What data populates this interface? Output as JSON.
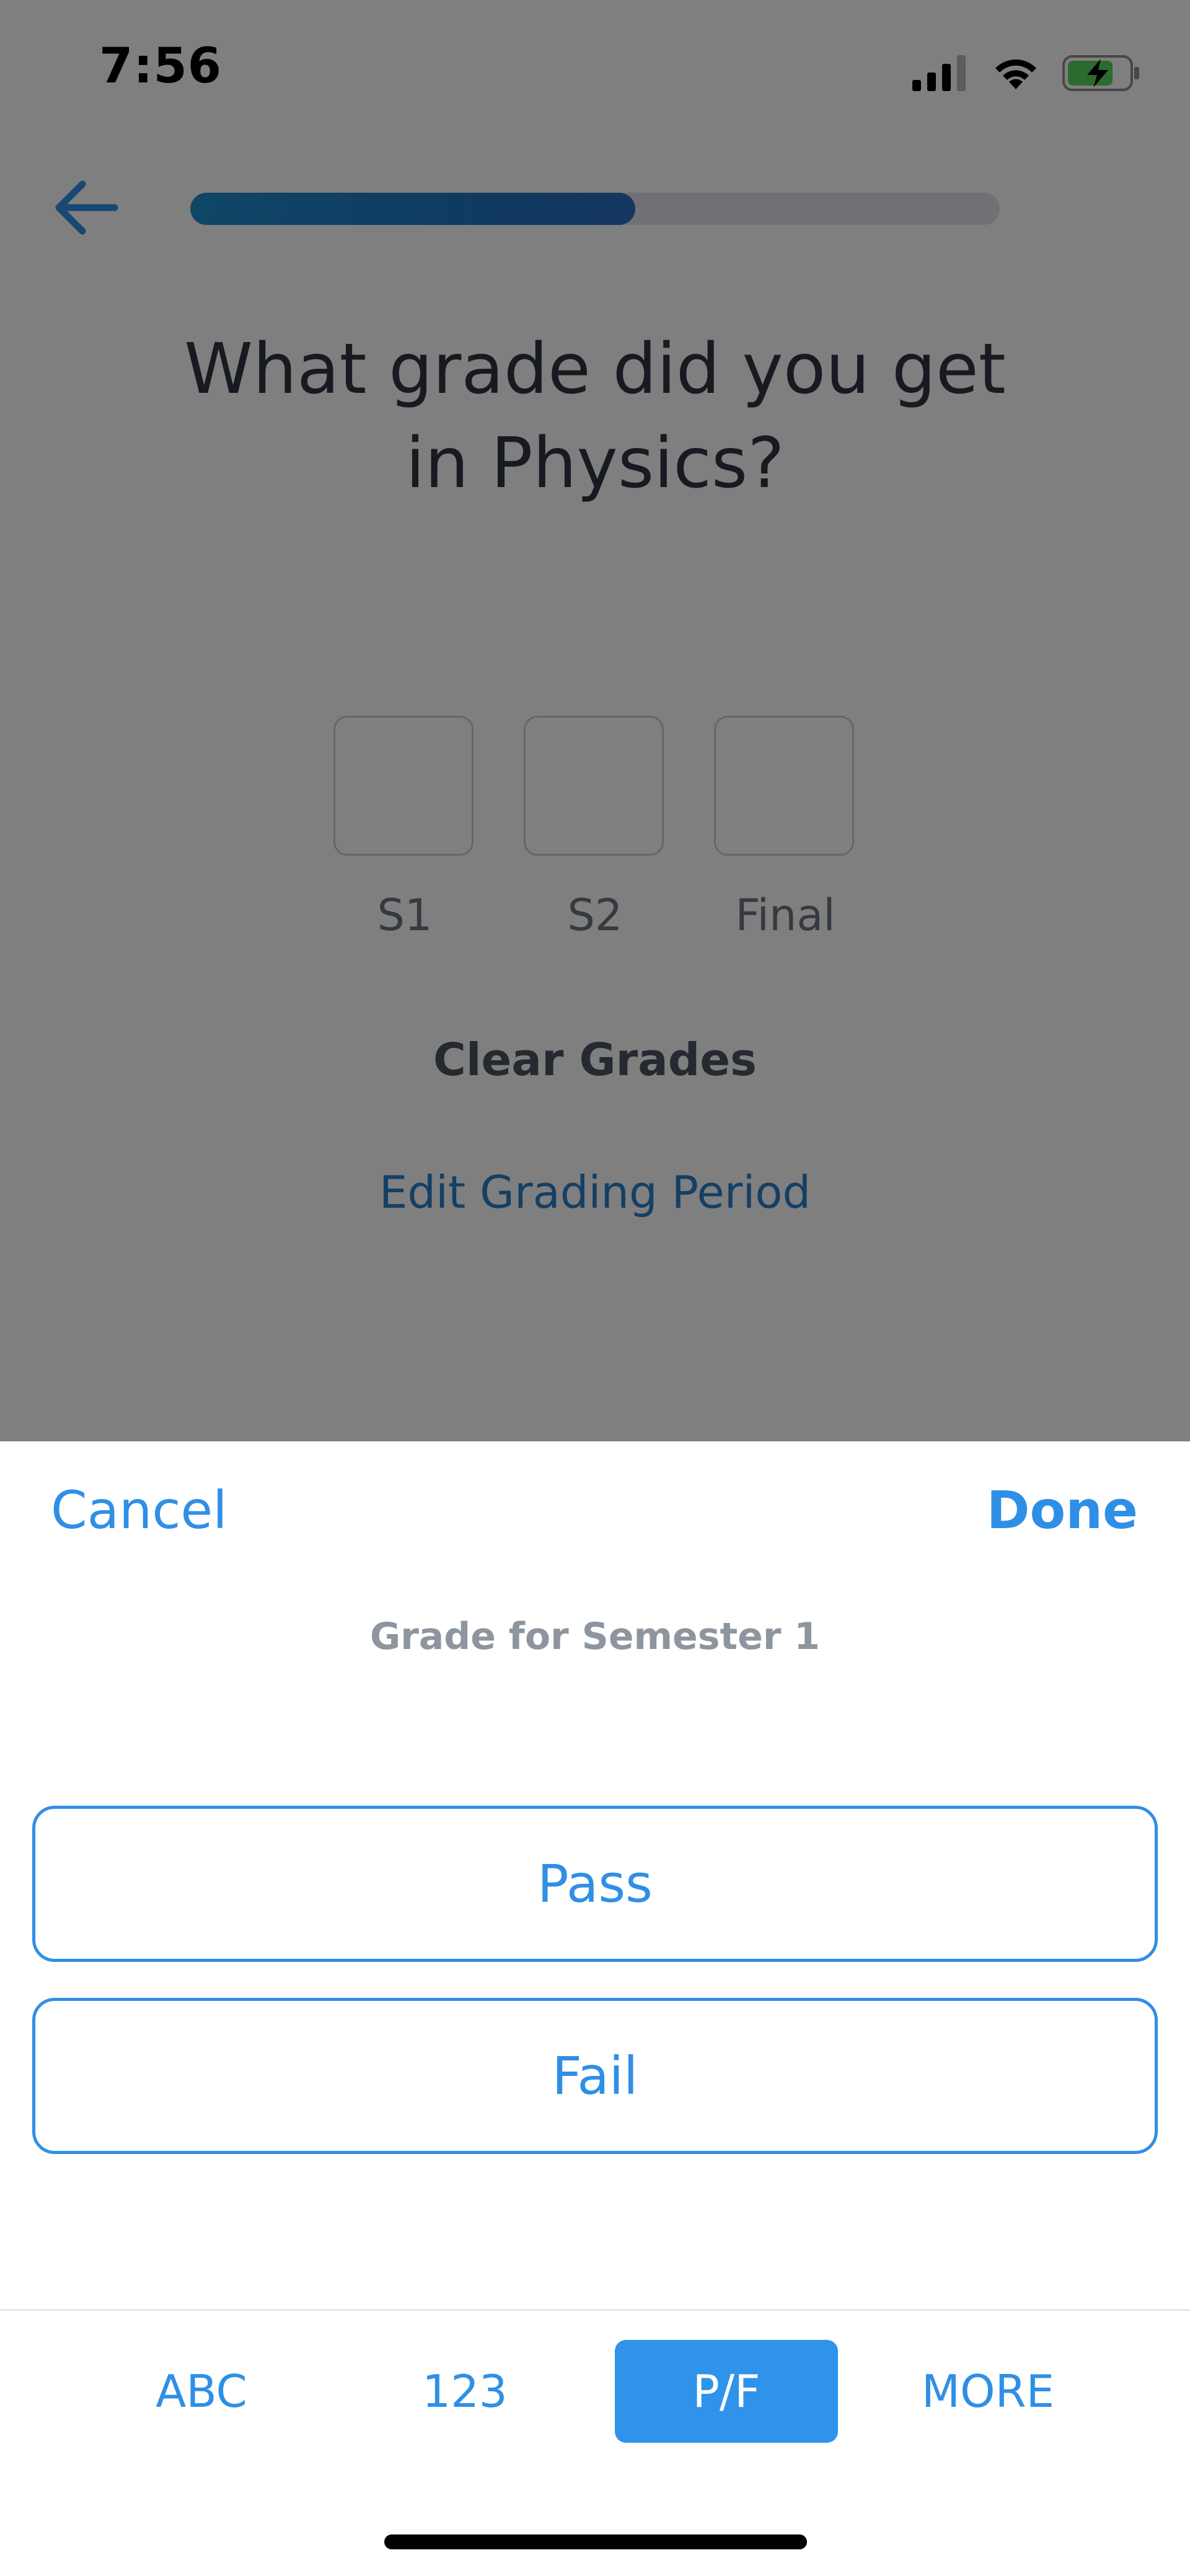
{
  "status_bar": {
    "time": "7:56",
    "icons": [
      "signal-icon",
      "wifi-icon",
      "battery-charging-icon"
    ]
  },
  "header": {
    "back_icon": "arrow-left-icon",
    "progress": 0.55
  },
  "question": {
    "line1": "What grade did you get",
    "line2": "in Physics?"
  },
  "grade_periods": [
    {
      "label": "S1",
      "value": ""
    },
    {
      "label": "S2",
      "value": ""
    },
    {
      "label": "Final",
      "value": ""
    }
  ],
  "actions": {
    "clear_grades": "Clear Grades",
    "edit_grading_period": "Edit Grading Period"
  },
  "sheet": {
    "cancel": "Cancel",
    "done": "Done",
    "subtitle": "Grade for Semester 1",
    "options": [
      "Pass",
      "Fail"
    ],
    "tabs": [
      {
        "label": "ABC",
        "active": false
      },
      {
        "label": "123",
        "active": false
      },
      {
        "label": "P/F",
        "active": true
      },
      {
        "label": "MORE",
        "active": false
      }
    ]
  },
  "colors": {
    "accent": "#2f8fe6",
    "overlay": "rgba(0,0,0,0.5)",
    "progress_fill": "#1f78c4"
  }
}
